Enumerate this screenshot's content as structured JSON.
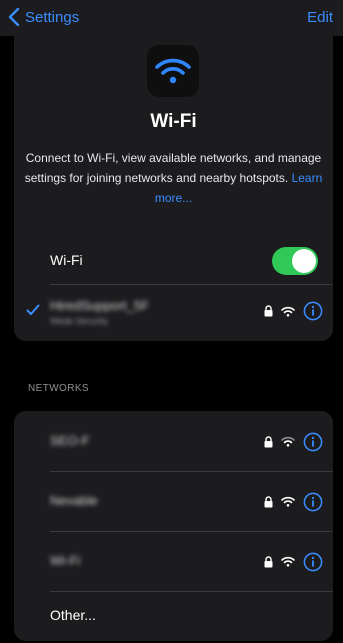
{
  "nav": {
    "back_label": "Settings",
    "edit_label": "Edit"
  },
  "header": {
    "icon": "wifi-icon",
    "title": "Wi-Fi",
    "description": "Connect to Wi-Fi, view available networks, and manage settings for joining networks and nearby hotspots.",
    "learn_more": "Learn more..."
  },
  "wifi_toggle": {
    "label": "Wi-Fi",
    "on": true
  },
  "connected": {
    "name": "HiredSupport_5F",
    "security": "Weak Security",
    "locked": true
  },
  "networks_header": "NETWORKS",
  "networks": [
    {
      "name": "SEO-F",
      "locked": true
    },
    {
      "name": "Nevable",
      "locked": true
    },
    {
      "name": "Wi-Fi",
      "locked": true
    }
  ],
  "other_label": "Other...",
  "colors": {
    "accent": "#3a8dff",
    "toggle_on": "#30c958",
    "card_bg": "#1c1c1e",
    "background": "#000000"
  }
}
